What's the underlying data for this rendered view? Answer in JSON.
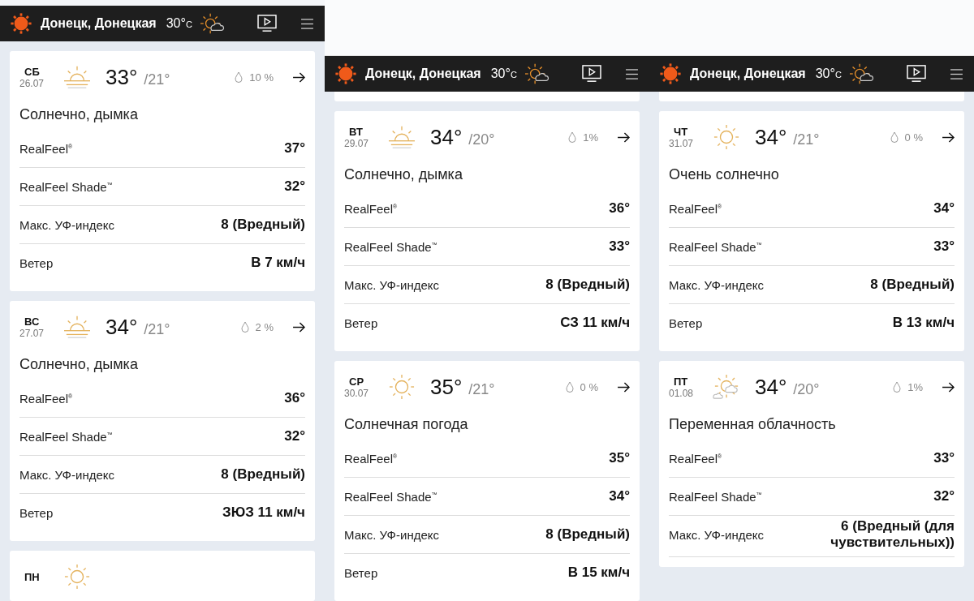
{
  "columns": [
    {
      "header": {
        "location": "Донецк, Донецкая",
        "temp": "30°",
        "unit": "C"
      },
      "stub_above": false,
      "days": [
        {
          "day": "СБ",
          "date": "26.07",
          "kind": "haze",
          "high": "33°",
          "low": "/21°",
          "precip": "10 %",
          "condition": "Солнечно, дымка",
          "rows": [
            {
              "label": "RealFeel$^{®}$",
              "value": "37°"
            },
            {
              "label": "RealFeel Shade$^{™}$",
              "value": "32°"
            },
            {
              "label": "Макс. УФ-индекс",
              "value": "8 (Вредный)"
            },
            {
              "label": "Ветер",
              "value": "В 7 км/ч"
            }
          ]
        },
        {
          "day": "ВС",
          "date": "27.07",
          "kind": "haze",
          "high": "34°",
          "low": "/21°",
          "precip": "2 %",
          "condition": "Солнечно, дымка",
          "rows": [
            {
              "label": "RealFeel$^{®}$",
              "value": "36°"
            },
            {
              "label": "RealFeel Shade$^{™}$",
              "value": "32°"
            },
            {
              "label": "Макс. УФ-индекс",
              "value": "8 (Вредный)"
            },
            {
              "label": "Ветер",
              "value": "ЗЮЗ 11 км/ч"
            }
          ]
        },
        {
          "day": "ПН",
          "kind": "sunny"
        }
      ]
    },
    {
      "header": {
        "location": "Донецк, Донецкая",
        "temp": "30°",
        "unit": "C"
      },
      "stub_above": true,
      "days": [
        {
          "day": "ВТ",
          "date": "29.07",
          "kind": "haze",
          "high": "34°",
          "low": "/20°",
          "precip": "1%",
          "condition": "Солнечно, дымка",
          "rows": [
            {
              "label": "RealFeel$^{®}$",
              "value": "36°"
            },
            {
              "label": "RealFeel Shade$^{™}$",
              "value": "33°"
            },
            {
              "label": "Макс. УФ-индекс",
              "value": "8 (Вредный)"
            },
            {
              "label": "Ветер",
              "value": "СЗ 11 км/ч"
            }
          ]
        },
        {
          "day": "СР",
          "date": "30.07",
          "kind": "sunny",
          "high": "35°",
          "low": "/21°",
          "precip": "0 %",
          "condition": "Солнечная погода",
          "rows": [
            {
              "label": "RealFeel$^{®}$",
              "value": "35°"
            },
            {
              "label": "RealFeel Shade$^{™}$",
              "value": "34°"
            },
            {
              "label": "Макс. УФ-индекс",
              "value": "8 (Вредный)"
            },
            {
              "label": "Ветер",
              "value": "В 15 км/ч"
            }
          ]
        }
      ]
    },
    {
      "header": {
        "location": "Донецк, Донецкая",
        "temp": "30°",
        "unit": "C"
      },
      "stub_above": true,
      "days": [
        {
          "day": "ЧТ",
          "date": "31.07",
          "kind": "sunny",
          "high": "34°",
          "low": "/21°",
          "precip": "0 %",
          "condition": "Очень солнечно",
          "rows": [
            {
              "label": "RealFeel$^{®}$",
              "value": "34°"
            },
            {
              "label": "RealFeel Shade$^{™}$",
              "value": "33°"
            },
            {
              "label": "Макс. УФ-индекс",
              "value": "8 (Вредный)"
            },
            {
              "label": "Ветер",
              "value": "В 13 км/ч"
            }
          ]
        },
        {
          "day": "ПТ",
          "date": "01.08",
          "kind": "partly_cloudy",
          "high": "34°",
          "low": "/20°",
          "precip": "1%",
          "condition": "Переменная облачность",
          "rows": [
            {
              "label": "RealFeel$^{®}$",
              "value": "33°"
            },
            {
              "label": "RealFeel Shade$^{™}$",
              "value": "32°"
            },
            {
              "label": "Макс. УФ-индекс",
              "value": "6 (Вредный (для чувствительных))"
            }
          ]
        }
      ]
    }
  ]
}
